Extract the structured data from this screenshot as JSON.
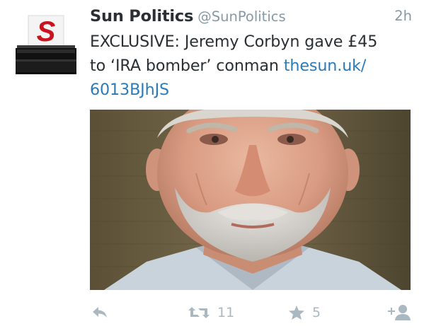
{
  "tweet": {
    "display_name": "Sun Politics",
    "handle": "@SunPolitics",
    "time": "2h",
    "text_line1": "EXCLUSIVE: Jeremy Corbyn gave £45",
    "text_line2_a": "to ‘IRA bomber’ conman ",
    "link_part1": "thesun.uk/",
    "link_part2": "6013BJhJS",
    "retweet_count": "11",
    "favorite_count": "5"
  },
  "avatar": {
    "letter": "S",
    "letter_color": "#c8141e",
    "box_color": "#1c1c1c"
  },
  "colors": {
    "text": "#292f33",
    "muted": "#8899a6",
    "link": "#2b7bb9",
    "action_icon": "#aab8c2"
  }
}
